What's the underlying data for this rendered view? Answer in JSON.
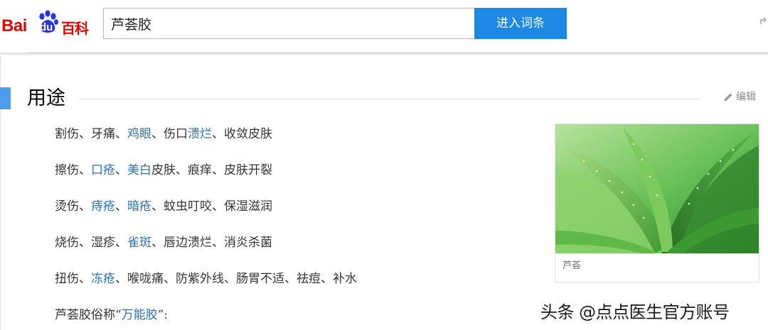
{
  "header": {
    "logo": {
      "bai": "Bai",
      "du": "du",
      "baike": "百科"
    },
    "search": {
      "value": "芦荟胶"
    },
    "search_button_label": "进入词条",
    "accent_color": "#1e88e5",
    "brand_color": "#e10602"
  },
  "section": {
    "title": "用途",
    "edit_label": "编辑",
    "lines": [
      [
        {
          "text": "割伤、牙痛、"
        },
        {
          "text": "鸡眼",
          "link": true
        },
        {
          "text": "、伤口"
        },
        {
          "text": "溃烂",
          "link": true
        },
        {
          "text": "、收敛皮肤"
        }
      ],
      [
        {
          "text": "擦伤、"
        },
        {
          "text": "口疮",
          "link": true
        },
        {
          "text": "、"
        },
        {
          "text": "美白",
          "link": true
        },
        {
          "text": "皮肤、痕痒、皮肤开裂"
        }
      ],
      [
        {
          "text": "烫伤、"
        },
        {
          "text": "痔疮",
          "link": true
        },
        {
          "text": "、"
        },
        {
          "text": "暗疮",
          "link": true
        },
        {
          "text": "、蚊虫叮咬、保湿滋润"
        }
      ],
      [
        {
          "text": "烧伤、湿疹、"
        },
        {
          "text": "雀斑",
          "link": true
        },
        {
          "text": "、唇边溃烂、消炎杀菌"
        }
      ],
      [
        {
          "text": "扭伤、"
        },
        {
          "text": "冻疮",
          "link": true
        },
        {
          "text": "、喉咙痛、防紫外线、肠胃不适、祛痘、补水"
        }
      ],
      [
        {
          "text": "芦荟胶俗称“"
        },
        {
          "text": "万能胶",
          "link": true
        },
        {
          "text": "”:"
        }
      ]
    ],
    "link_color": "#2e6eb5"
  },
  "figure": {
    "caption": "芦荟",
    "icon": "aloe-plant-photo"
  },
  "watermark": "头条 @点点医生官方账号"
}
